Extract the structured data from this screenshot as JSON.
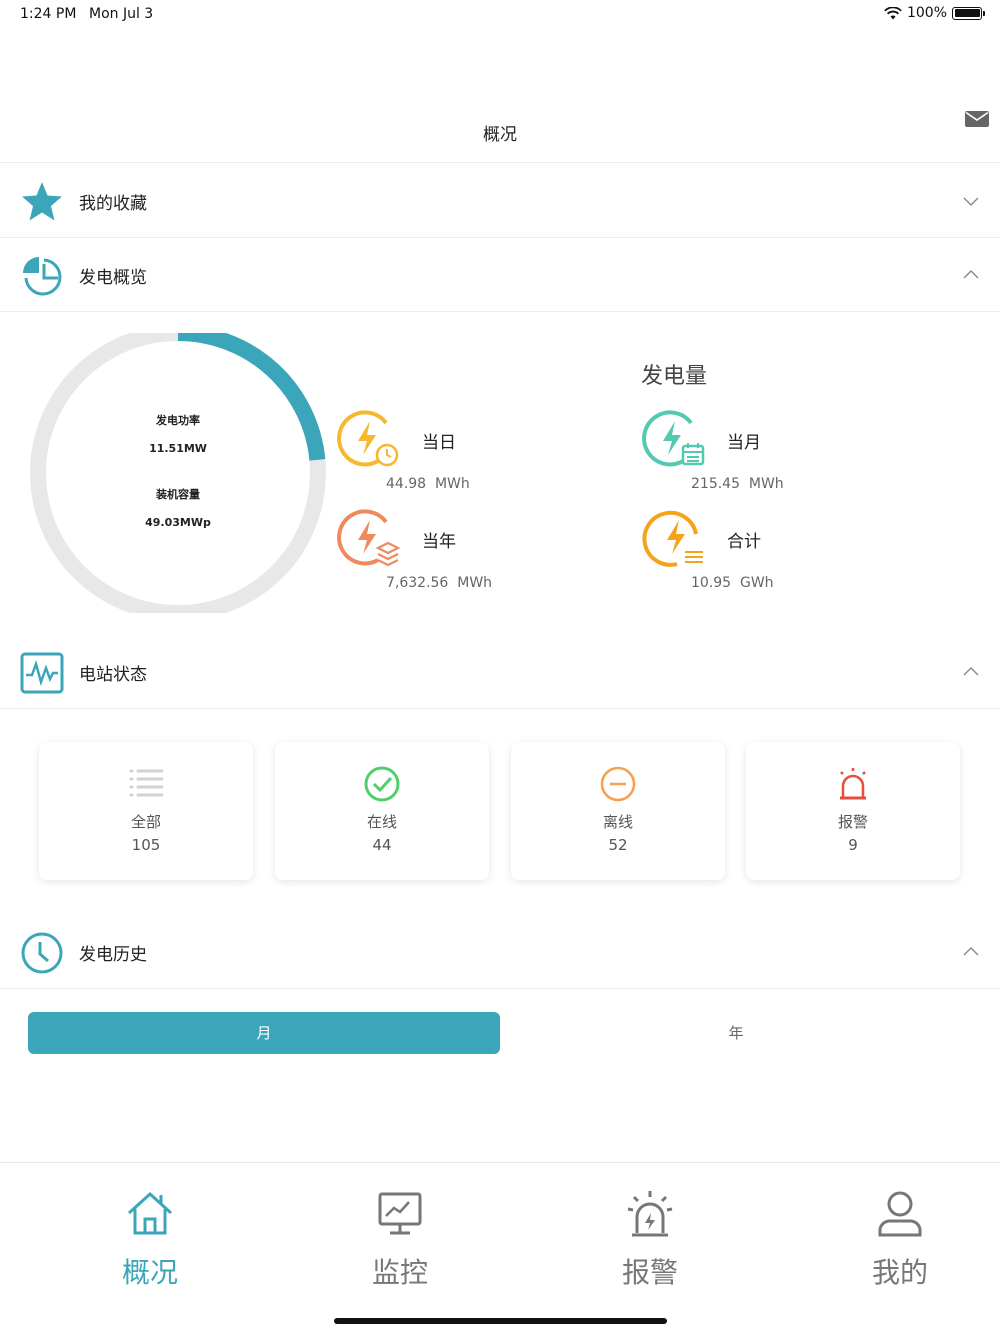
{
  "status_bar": {
    "time": "1:24 PM",
    "date": "Mon Jul 3",
    "battery": "100%"
  },
  "nav": {
    "title": "概况"
  },
  "sections": {
    "favorites": "我的收藏",
    "overview": "发电概览",
    "station_status": "电站状态",
    "history": "发电历史"
  },
  "gauge": {
    "power_label": "发电功率",
    "power_value": "11.51MW",
    "capacity_label": "装机容量",
    "capacity_value": "49.03MWp",
    "fraction": 0.235
  },
  "generation": {
    "title": "发电量",
    "day": {
      "label": "当日",
      "value": "44.98  MWh"
    },
    "month": {
      "label": "当月",
      "value": "215.45  MWh"
    },
    "year": {
      "label": "当年",
      "value": "7,632.56  MWh"
    },
    "total": {
      "label": "合计",
      "value": "10.95  GWh"
    }
  },
  "status_cards": [
    {
      "label": "全部",
      "value": "105"
    },
    {
      "label": "在线",
      "value": "44"
    },
    {
      "label": "离线",
      "value": "52"
    },
    {
      "label": "报警",
      "value": "9"
    }
  ],
  "history_tabs": {
    "month": "月",
    "year": "年"
  },
  "tabbar": {
    "overview": "概况",
    "monitor": "监控",
    "alarm": "报警",
    "mine": "我的"
  },
  "colors": {
    "accent": "#3ba6b9",
    "yellow": "#f5b82e",
    "orange": "#f08a5d",
    "green": "#4dcf6a",
    "red": "#e84c3d"
  }
}
